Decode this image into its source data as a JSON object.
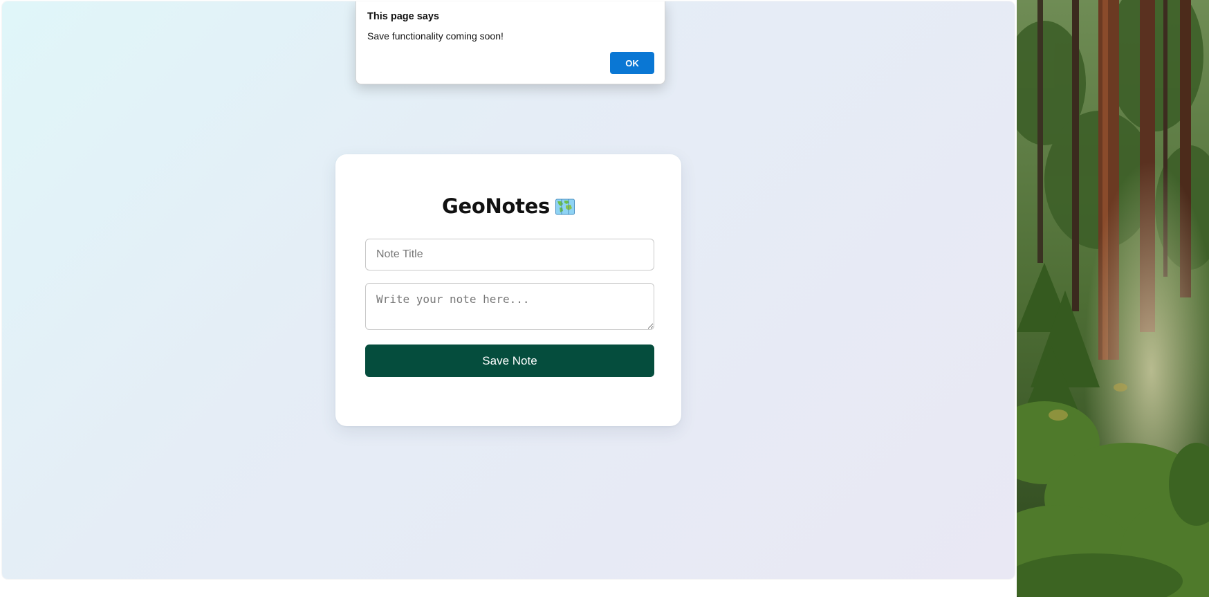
{
  "alert": {
    "heading": "This page says",
    "message": "Save functionality coming soon!",
    "ok_label": "OK"
  },
  "app": {
    "title": "GeoNotes",
    "title_icon": "world-map-icon"
  },
  "form": {
    "title_placeholder": "Note Title",
    "title_value": "",
    "note_placeholder": "Write your note here...",
    "note_value": "",
    "save_label": "Save Note"
  },
  "colors": {
    "save_button": "#054d3d",
    "alert_ok": "#0a77d4"
  }
}
